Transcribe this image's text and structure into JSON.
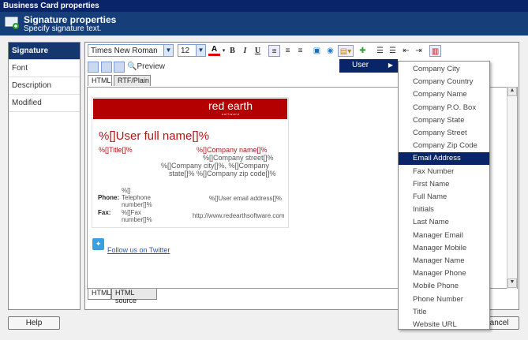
{
  "window": {
    "title": "Business Card properties"
  },
  "header": {
    "title": "Signature properties",
    "subtitle": "Specify signature text."
  },
  "sidebar": {
    "items": [
      {
        "label": "Signature",
        "active": true
      },
      {
        "label": "Font"
      },
      {
        "label": "Description"
      },
      {
        "label": "Modified"
      }
    ]
  },
  "toolbar": {
    "font_family": "Times New Roman",
    "font_size": "12",
    "bold": "B",
    "italic": "I",
    "underline": "U",
    "preview": "Preview"
  },
  "tabs": {
    "top": [
      "HTML",
      "RTF/Plain"
    ],
    "bottom": [
      "HTML",
      "HTML source"
    ]
  },
  "card": {
    "logo": "red earth",
    "logo_sub": "software",
    "name": "%[]User full name[]%",
    "title": "%[]Title[]%",
    "company_name": "%[]Company name[]%",
    "company_street": "%[]Company street[]%",
    "company_city_line": "%[]Company city[]%, %[]Company",
    "company_state_line": "state[]% %[]Company zip code[]%",
    "phone_label": "Phone:",
    "phone_value_1": "%[]",
    "phone_value_2": "Telephone",
    "phone_value_3": "number[]%",
    "fax_label": "Fax:",
    "fax_value_1": "%[]Fax",
    "fax_value_2": "number[]%",
    "email": "%[]User email address[]%",
    "website": "http://www.redearthsoftware.com",
    "twitter_text": "Follow us on Twitter"
  },
  "menu": {
    "label": "User"
  },
  "submenu": {
    "items": [
      "Company City",
      "Company Country",
      "Company Name",
      "Company P.O. Box",
      "Company State",
      "Company Street",
      "Company Zip Code",
      "Email Address",
      "Fax Number",
      "First Name",
      "Full Name",
      "Initials",
      "Last Name",
      "Manager Email",
      "Manager Mobile",
      "Manager Name",
      "Manager Phone",
      "Mobile Phone",
      "Phone Number",
      "Title",
      "Website URL"
    ],
    "highlighted": "Email Address"
  },
  "buttons": {
    "help": "Help",
    "cancel": "Cancel"
  },
  "colors": {
    "brand": "#b40000",
    "header": "#163f7a",
    "selection": "#0a246a"
  }
}
